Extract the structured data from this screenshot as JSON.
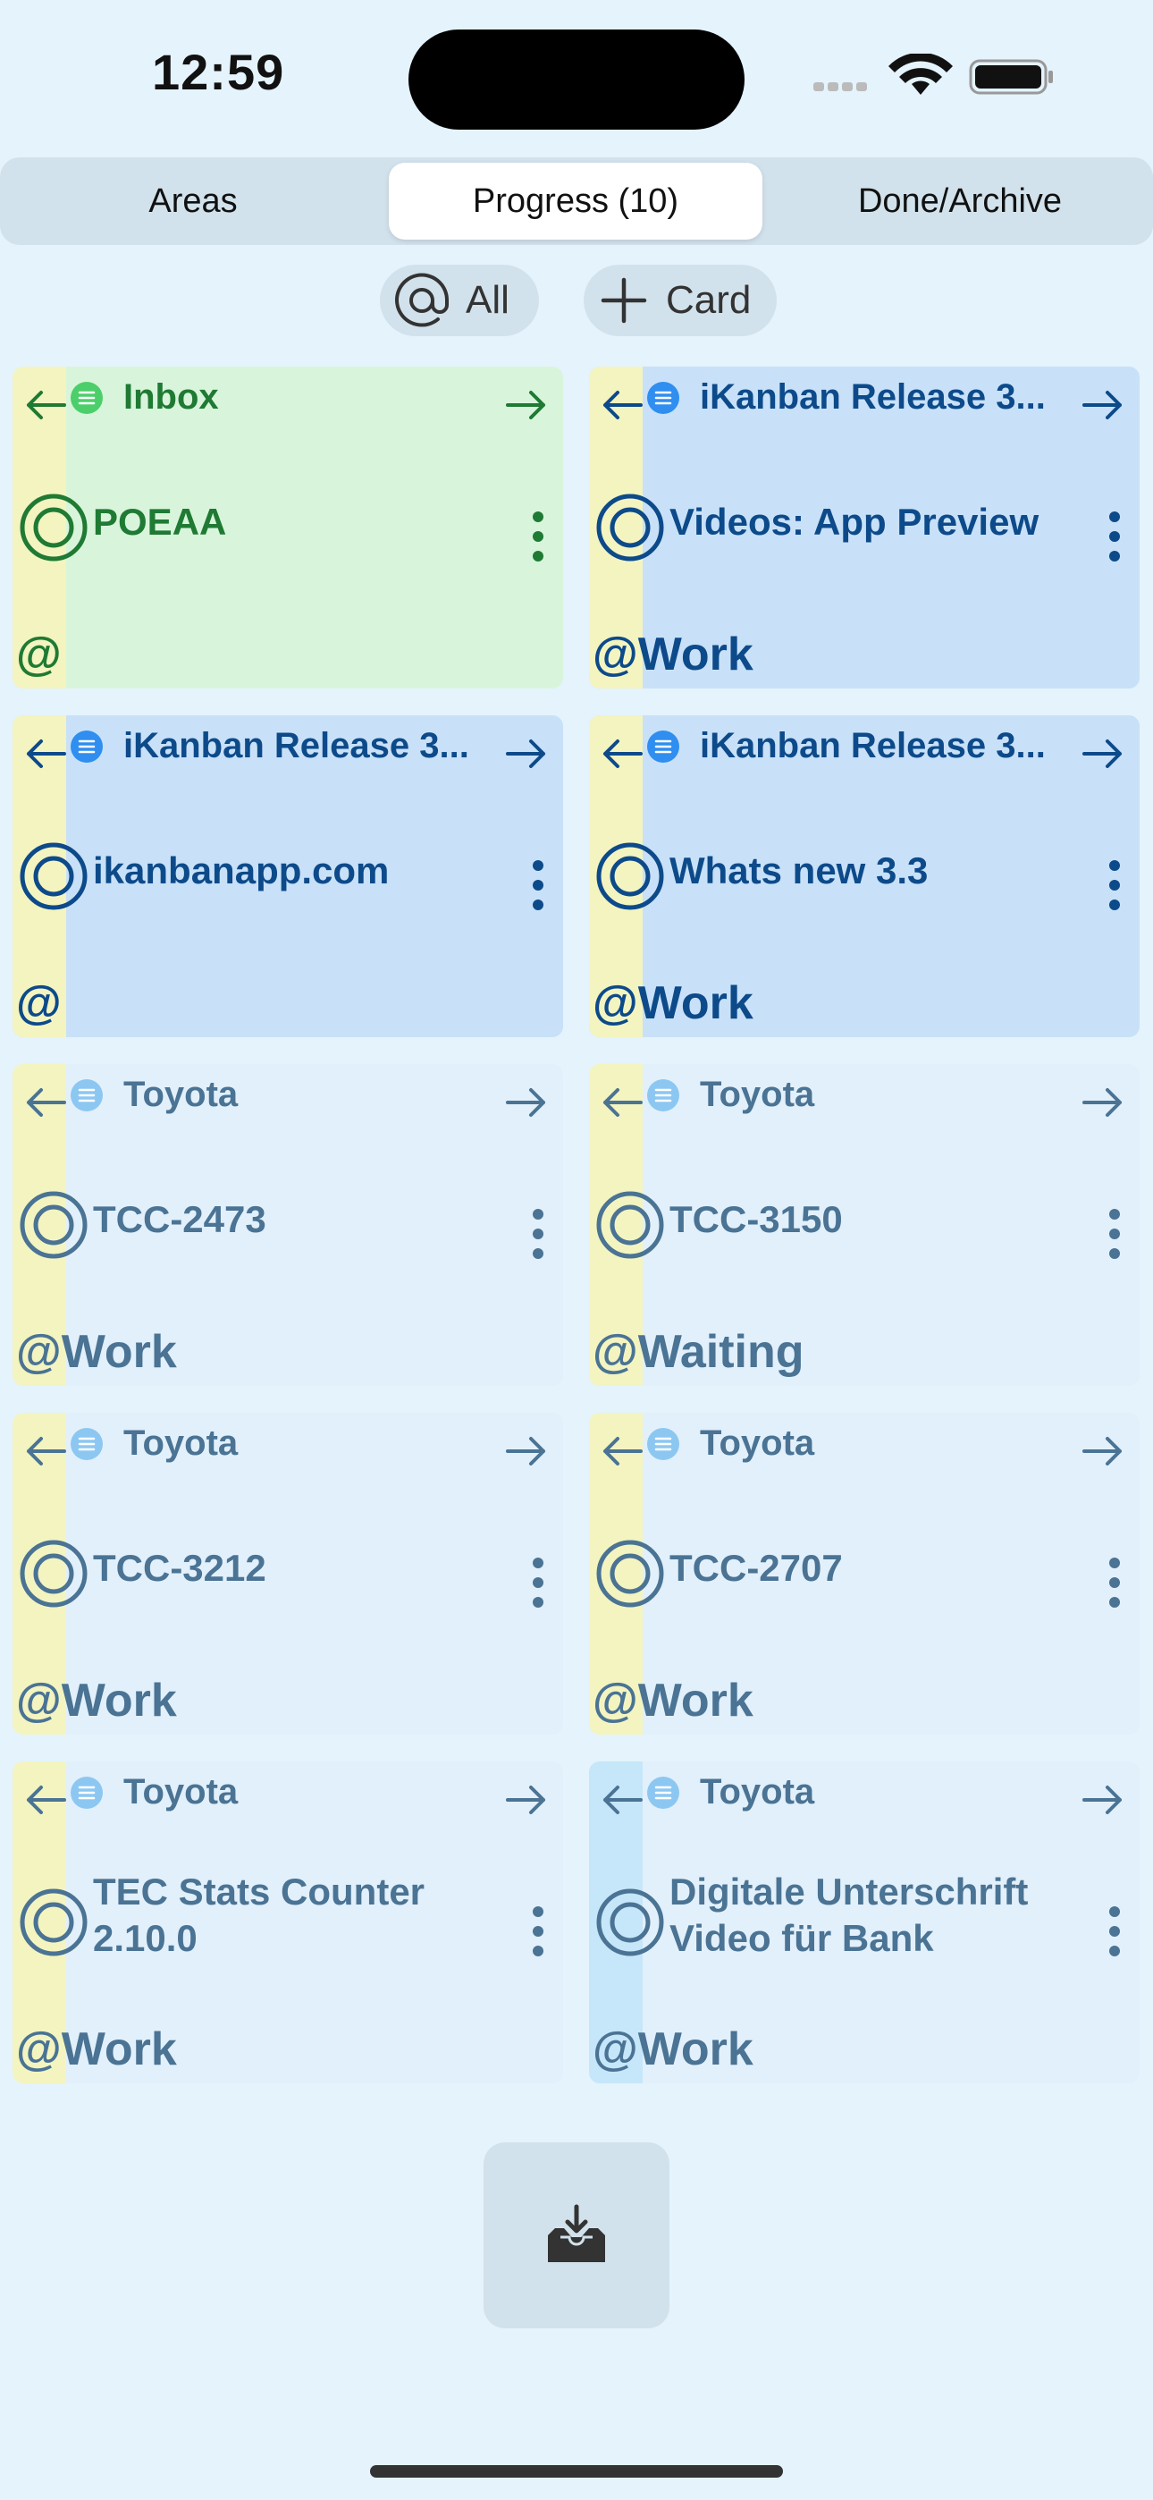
{
  "status": {
    "time": "12:59"
  },
  "tabs": [
    {
      "label": "Areas"
    },
    {
      "label": "Progress (10)"
    },
    {
      "label": "Done/Archive"
    }
  ],
  "filters": {
    "context": {
      "label": "All",
      "icon": "at-icon"
    },
    "add": {
      "label": "Card",
      "icon": "plus-icon"
    }
  },
  "cards": [
    {
      "project": "Inbox",
      "title": "POEAA",
      "context": "@"
    },
    {
      "project": "iKanban Release 3...",
      "title": "Videos: App Preview",
      "context": "@Work"
    },
    {
      "project": "iKanban Release 3...",
      "title": "ikanbanapp.com",
      "context": "@"
    },
    {
      "project": "iKanban Release 3...",
      "title": "Whats new 3.3",
      "context": "@Work"
    },
    {
      "project": "Toyota",
      "title": "TCC-2473",
      "context": "@Work"
    },
    {
      "project": "Toyota",
      "title": "TCC-3150",
      "context": "@Waiting"
    },
    {
      "project": "Toyota",
      "title": "TCC-3212",
      "context": "@Work"
    },
    {
      "project": "Toyota",
      "title": "TCC-2707",
      "context": "@Work"
    },
    {
      "project": "Toyota",
      "title": "TEC Stats Counter 2.10.0",
      "context": "@Work"
    },
    {
      "project": "Toyota",
      "title": "Digitale Unterschrift Video für Bank",
      "context": "@Work"
    }
  ],
  "colors": {
    "background": "#e4f3fc",
    "inbox_card": "#d8f5dc",
    "inbox_text": "#1f7a33",
    "release_card": "#c8e1f8",
    "release_text": "#0d4a8a",
    "toyota_card": "#e2f0fb",
    "toyota_text": "#4a7394",
    "strip_yellow": "#f3f4c0",
    "strip_blue": "#c6e6fa"
  },
  "bottom_button": {
    "icon": "inbox-download-icon"
  }
}
